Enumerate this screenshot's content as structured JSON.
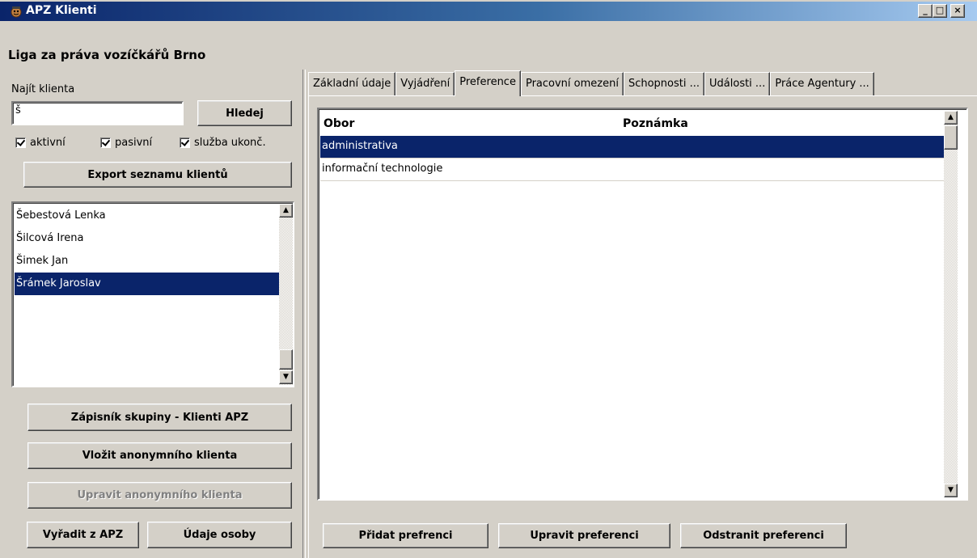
{
  "window": {
    "title": "APZ Klienti",
    "controls": {
      "minimize": "_",
      "maximize": "□",
      "close": "×"
    }
  },
  "organization": "Liga za práva vozíčkářů Brno",
  "search": {
    "label": "Najít klienta",
    "value": "š",
    "button": "Hledej"
  },
  "filters": {
    "active_label": "aktivní",
    "passive_label": "pasivní",
    "ended_label": "služba ukonč.",
    "active_checked": true,
    "passive_checked": true,
    "ended_checked": true
  },
  "export_button": "Export seznamu klientů",
  "clients": [
    {
      "name": "Šebestová Lenka",
      "selected": false
    },
    {
      "name": "Šilcová Irena",
      "selected": false
    },
    {
      "name": "Šimek Jan",
      "selected": false
    },
    {
      "name": "Šrámek Jaroslav",
      "selected": true
    }
  ],
  "left_buttons": {
    "notebook": "Zápisník skupiny - Klienti APZ",
    "insert_anonymous": "Vložit anonymního klienta",
    "edit_anonymous": "Upravit anonymního klienta",
    "remove": "Vyřadit z APZ",
    "person_data": "Údaje osoby"
  },
  "tabs": [
    {
      "label": "Základní údaje",
      "active": false
    },
    {
      "label": "Vyjádření",
      "active": false
    },
    {
      "label": "Preference",
      "active": true
    },
    {
      "label": "Pracovní omezení",
      "active": false
    },
    {
      "label": "Schopnosti ...",
      "active": false
    },
    {
      "label": "Události ...",
      "active": false
    },
    {
      "label": "Práce Agentury ...",
      "active": false
    }
  ],
  "preferences": {
    "columns": [
      "Obor",
      "Poznámka"
    ],
    "rows": [
      {
        "obor": "administrativa",
        "poznamka": "",
        "selected": true
      },
      {
        "obor": "informační technologie",
        "poznamka": "",
        "selected": false
      }
    ],
    "buttons": {
      "add": "Přidat prefrenci",
      "edit": "Upravit preferenci",
      "remove": "Odstranit preferenci"
    }
  },
  "colors": {
    "face": "#d4d0c8",
    "selection": "#0a246a",
    "title_start": "#0a246a",
    "title_end": "#a6caf0"
  }
}
